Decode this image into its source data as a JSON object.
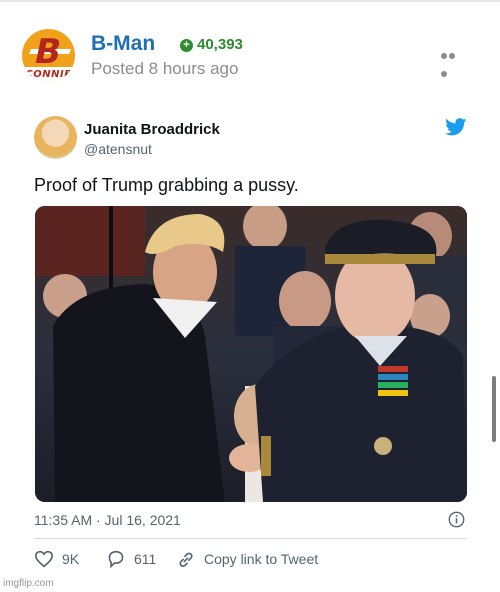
{
  "post": {
    "username": "B-Man",
    "points": "40,393",
    "posted_time": "Posted 8 hours ago",
    "avatar_text": "CONNIE",
    "avatar_letter": "B"
  },
  "tweet": {
    "author_name": "Juanita Broaddrick",
    "author_handle": "@atensnut",
    "text": "Proof of Trump grabbing a pussy.",
    "timestamp": "11:35 AM · Jul 16, 2021",
    "likes": "9K",
    "replies": "611",
    "copy_link_label": "Copy link to Tweet"
  },
  "watermark": "imgflip.com",
  "colors": {
    "username": "#1f6fb5",
    "points": "#2e8b2e",
    "twitter_blue": "#1d9bf0",
    "muted": "#536471"
  },
  "icons": [
    "plus-circle-icon",
    "more-icon",
    "twitter-bird-icon",
    "info-icon",
    "heart-icon",
    "reply-icon",
    "link-icon"
  ]
}
